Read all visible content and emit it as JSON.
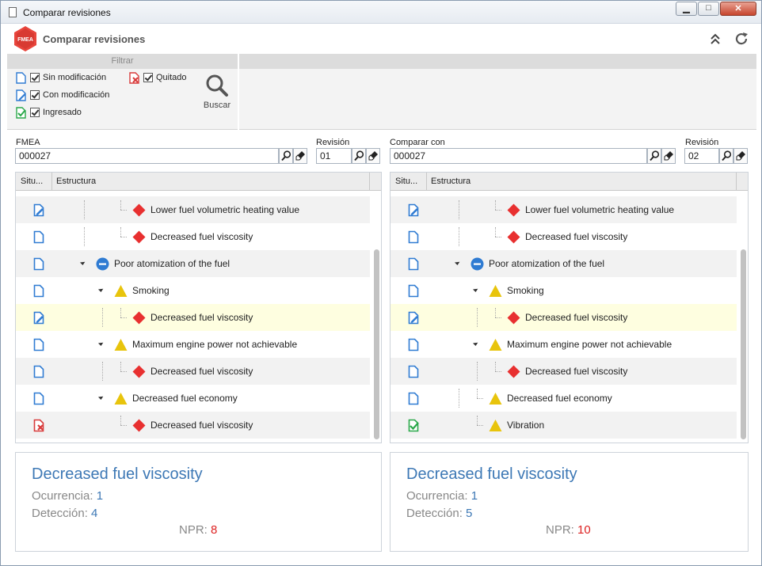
{
  "window": {
    "title": "Comparar revisiones"
  },
  "header": {
    "title": "Comparar revisiones",
    "logo_text": "FMEA"
  },
  "filter": {
    "title": "Filtrar",
    "items": [
      {
        "label": "Sin modificación",
        "checked": true,
        "icon": "doc-unchanged-icon"
      },
      {
        "label": "Con modificación",
        "checked": true,
        "icon": "doc-modified-icon"
      },
      {
        "label": "Ingresado",
        "checked": true,
        "icon": "doc-added-icon"
      },
      {
        "label": "Quitado",
        "checked": true,
        "icon": "doc-removed-icon"
      }
    ],
    "search_label": "Buscar"
  },
  "left": {
    "fmea_label": "FMEA",
    "fmea_value": "000027",
    "rev_label": "Revisión",
    "rev_value": "01",
    "col_situation": "Situ...",
    "col_structure": "Estructura",
    "rows": [
      {
        "status": "modified",
        "type": "diamond",
        "label": "Lower fuel volumetric heating value"
      },
      {
        "status": "unchanged",
        "type": "diamond",
        "label": "Decreased fuel viscosity"
      },
      {
        "status": "unchanged",
        "type": "minus",
        "label": "Poor atomization of the fuel"
      },
      {
        "status": "unchanged",
        "type": "triangle",
        "label": "Smoking"
      },
      {
        "status": "modified",
        "type": "diamond",
        "label": "Decreased fuel viscosity"
      },
      {
        "status": "unchanged",
        "type": "triangle",
        "label": "Maximum engine power not achievable"
      },
      {
        "status": "unchanged",
        "type": "diamond",
        "label": "Decreased fuel viscosity"
      },
      {
        "status": "unchanged",
        "type": "triangle",
        "label": "Decreased fuel economy"
      },
      {
        "status": "removed",
        "type": "diamond",
        "label": "Decreased fuel viscosity"
      }
    ],
    "detail": {
      "title": "Decreased fuel viscosity",
      "occurrence_label": "Ocurrencia:",
      "occurrence_value": "1",
      "detection_label": "Detección:",
      "detection_value": "4",
      "npr_label": "NPR:",
      "npr_value": "8"
    }
  },
  "right": {
    "compare_label": "Comparar con",
    "fmea_value": "000027",
    "rev_label": "Revisión",
    "rev_value": "02",
    "col_situation": "Situ...",
    "col_structure": "Estructura",
    "rows": [
      {
        "status": "modified",
        "type": "diamond",
        "label": "Lower fuel volumetric heating value"
      },
      {
        "status": "unchanged",
        "type": "diamond",
        "label": "Decreased fuel viscosity"
      },
      {
        "status": "unchanged",
        "type": "minus",
        "label": "Poor atomization of the fuel"
      },
      {
        "status": "unchanged",
        "type": "triangle",
        "label": "Smoking"
      },
      {
        "status": "modified",
        "type": "diamond",
        "label": "Decreased fuel viscosity"
      },
      {
        "status": "unchanged",
        "type": "triangle",
        "label": "Maximum engine power not achievable"
      },
      {
        "status": "unchanged",
        "type": "diamond",
        "label": "Decreased fuel viscosity"
      },
      {
        "status": "unchanged",
        "type": "triangle",
        "label": "Decreased fuel economy"
      },
      {
        "status": "added",
        "type": "triangle",
        "label": "Vibration"
      }
    ],
    "detail": {
      "title": "Decreased fuel viscosity",
      "occurrence_label": "Ocurrencia:",
      "occurrence_value": "1",
      "detection_label": "Detección:",
      "detection_value": "5",
      "npr_label": "NPR:",
      "npr_value": "10"
    }
  },
  "colors": {
    "accent": "#3d78b5",
    "npr": "#dd2222",
    "diamond": "#e83030",
    "triangle": "#e8c40c",
    "added": "#2aa84a",
    "removed": "#d83a3a"
  }
}
